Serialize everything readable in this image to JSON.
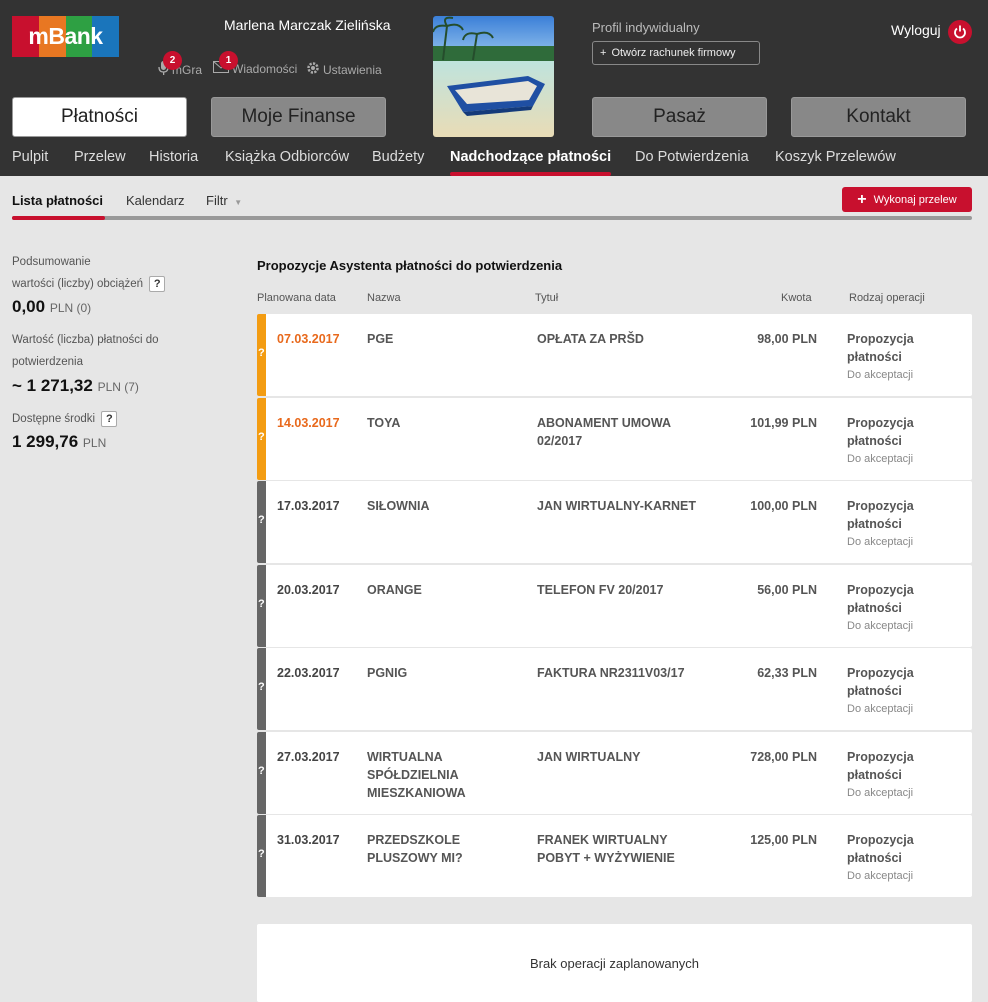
{
  "brand": {
    "logo_text": "mBank",
    "colors": [
      "#c8102e",
      "#e87722",
      "#2ea043",
      "#1a75bb"
    ]
  },
  "header": {
    "user_name": "Marlena Marczak Zielińska",
    "quick_links": [
      {
        "label": "mGra",
        "icon": "microphone-icon",
        "badge": "2"
      },
      {
        "label": "Wiadomości",
        "icon": "envelope-icon",
        "badge": "1"
      },
      {
        "label": "Ustawienia",
        "icon": "gear-icon"
      }
    ],
    "profile_label": "Profil indywidualny",
    "open_firm_label": "Otwórz rachunek firmowy",
    "logout_label": "Wyloguj",
    "main_buttons": [
      "Płatności",
      "Moje Finanse",
      "Pasaż",
      "Kontakt"
    ],
    "subnav": [
      "Pulpit",
      "Przelew",
      "Historia",
      "Książka Odbiorców",
      "Budżety",
      "Nadchodzące płatności",
      "Do Potwierdzenia",
      "Koszyk Przelewów"
    ]
  },
  "tabs": {
    "items": [
      "Lista płatności",
      "Kalendarz",
      "Filtr"
    ],
    "execute_label": "Wykonaj przelew"
  },
  "summary": {
    "label1a": "Podsumowanie",
    "label1b": "wartości (liczby) obciążeń",
    "value1": "0,00",
    "unit1": "PLN (0)",
    "label2a": "Wartość (liczba) płatności do",
    "label2b": "potwierdzenia",
    "value2": "~ 1 271,32",
    "unit2": "PLN (7)",
    "label3": "Dostępne środki",
    "value3": "1 299,76",
    "unit3": "PLN",
    "help": "?"
  },
  "table": {
    "title": "Propozycje Asystenta płatności do potwierdzenia",
    "headers": [
      "Planowana data",
      "Nazwa",
      "Tytuł",
      "Kwota",
      "Rodzaj operacji"
    ],
    "row_marker": "?",
    "rows": [
      {
        "date": "07.03.2017",
        "name": "PGE",
        "title": "OPŁATA ZA PRŠD",
        "amount": "98,00 PLN",
        "type1": "Propozycja",
        "type2": "płatności",
        "status": "Do akceptacji",
        "warn": true
      },
      {
        "date": "14.03.2017",
        "name": "TOYA",
        "title": "ABONAMENT UMOWA 02/2017",
        "amount": "101,99 PLN",
        "type1": "Propozycja",
        "type2": "płatności",
        "status": "Do akceptacji",
        "warn": true
      },
      {
        "date": "17.03.2017",
        "name": "SIŁOWNIA",
        "title": "JAN WIRTUALNY-KARNET",
        "amount": "100,00 PLN",
        "type1": "Propozycja",
        "type2": "płatności",
        "status": "Do akceptacji",
        "warn": false
      },
      {
        "date": "20.03.2017",
        "name": "ORANGE",
        "title": "TELEFON FV 20/2017",
        "amount": "56,00 PLN",
        "type1": "Propozycja",
        "type2": "płatności",
        "status": "Do akceptacji",
        "warn": false
      },
      {
        "date": "22.03.2017",
        "name": "PGNIG",
        "title": "FAKTURA NR2311V03/17",
        "amount": "62,33 PLN",
        "type1": "Propozycja",
        "type2": "płatności",
        "status": "Do akceptacji",
        "warn": false
      },
      {
        "date": "27.03.2017",
        "name": "WIRTUALNA SPÓŁDZIELNIA MIESZKANIOWA",
        "title": "JAN WIRTUALNY",
        "amount": "728,00 PLN",
        "type1": "Propozycja",
        "type2": "płatności",
        "status": "Do akceptacji",
        "warn": false
      },
      {
        "date": "31.03.2017",
        "name": "PRZEDSZKOLE PLUSZOWY MI?",
        "title": "FRANEK WIRTUALNY POBYT + WYŻYWIENIE",
        "amount": "125,00 PLN",
        "type1": "Propozycja",
        "type2": "płatności",
        "status": "Do akceptacji",
        "warn": false
      }
    ],
    "empty_message": "Brak operacji zaplanowanych"
  }
}
